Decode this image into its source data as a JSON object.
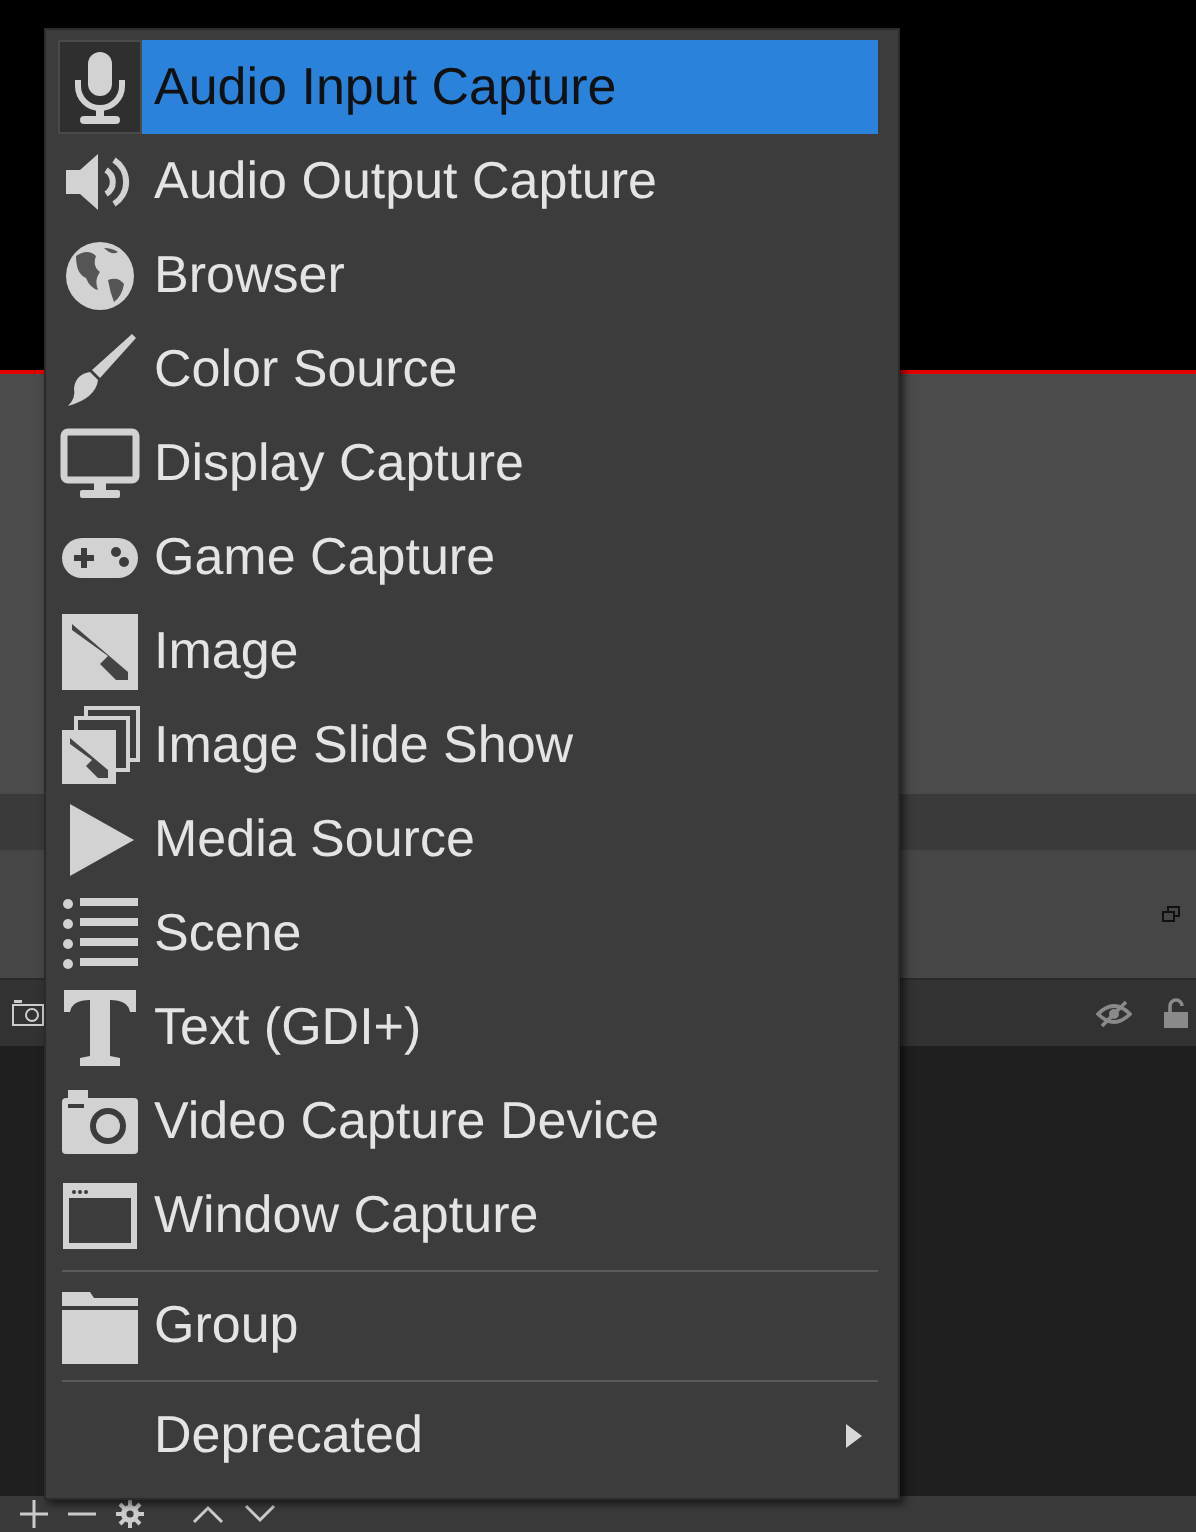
{
  "menu": {
    "items": [
      {
        "kind": "item",
        "label": "Audio Input Capture",
        "selected": true
      },
      {
        "kind": "item",
        "label": "Audio Output Capture",
        "selected": false
      },
      {
        "kind": "item",
        "label": "Browser",
        "selected": false
      },
      {
        "kind": "item",
        "label": "Color Source",
        "selected": false
      },
      {
        "kind": "item",
        "label": "Display Capture",
        "selected": false
      },
      {
        "kind": "item",
        "label": "Game Capture",
        "selected": false
      },
      {
        "kind": "item",
        "label": "Image",
        "selected": false
      },
      {
        "kind": "item",
        "label": "Image Slide Show",
        "selected": false
      },
      {
        "kind": "item",
        "label": "Media Source",
        "selected": false
      },
      {
        "kind": "item",
        "label": "Scene",
        "selected": false
      },
      {
        "kind": "item",
        "label": "Text (GDI+)",
        "selected": false
      },
      {
        "kind": "item",
        "label": "Video Capture Device",
        "selected": false
      },
      {
        "kind": "item",
        "label": "Window Capture",
        "selected": false
      },
      {
        "kind": "separator"
      },
      {
        "kind": "item",
        "label": "Group",
        "selected": false
      },
      {
        "kind": "separator"
      },
      {
        "kind": "submenu",
        "label": "Deprecated",
        "selected": false
      }
    ]
  }
}
